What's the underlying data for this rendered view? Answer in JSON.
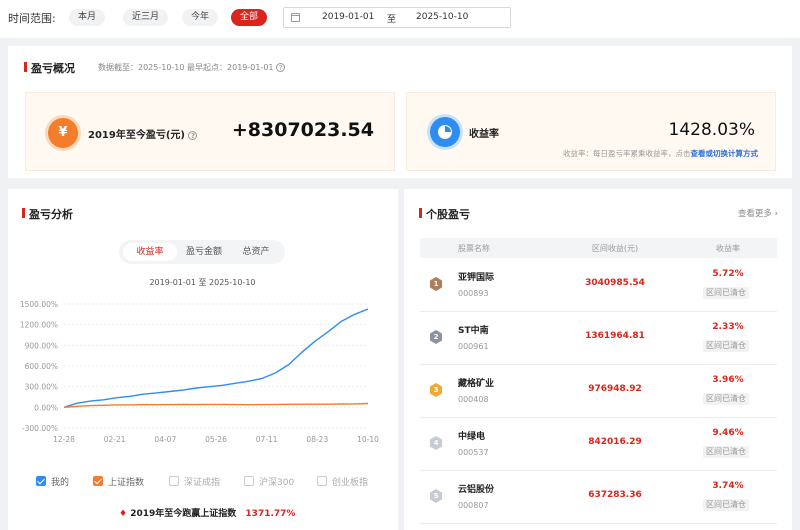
{
  "filter": {
    "label": "时间范围:",
    "options": [
      "本月",
      "近三月",
      "今年",
      "全部"
    ],
    "active": "全部",
    "start": "2019-01-01",
    "to": "至",
    "end": "2025-10-10"
  },
  "overview": {
    "title": "盈亏概况",
    "meta": "数据截至：2025-10-10  最早起点：2019-01-01",
    "profit_label": "2019年至今盈亏(元)",
    "profit_value": "+8307023.54",
    "yield_label": "收益率",
    "yield_value": "1428.03%",
    "note": "收益率：每日盈亏率累乘收益率，点击",
    "note_link": "查看或切换计算方式"
  },
  "analysis": {
    "title": "盈亏分析",
    "tabs": [
      "收益率",
      "盈亏金额",
      "总资产"
    ],
    "active_tab": "收益率",
    "range": "2019-01-01 至 2025-10-10",
    "legend": [
      "我的",
      "上证指数",
      "深证成指",
      "沪深300",
      "创业板指"
    ],
    "legend_on": [
      true,
      true,
      false,
      false,
      false
    ],
    "foot_label": "2019年至今跑赢上证指数",
    "foot_value": "1371.77%"
  },
  "chart_data": {
    "type": "line",
    "x": [
      "2018-12-28",
      "2019-02-21",
      "2019-04-07",
      "2019-05-26",
      "2019-07-11",
      "2019-08-23",
      "2019-10-10"
    ],
    "x_tick_labels": [
      "12-28",
      "02-21",
      "04-07",
      "05-26",
      "07-11",
      "08-23",
      "10-10"
    ],
    "y_tick_labels": [
      "1500.00%",
      "1200.00%",
      "900.00%",
      "600.00%",
      "300.00%",
      "0.00%",
      "-300.00%"
    ],
    "ylim": [
      -300,
      1500
    ],
    "grid": true,
    "legend_position": "bottom",
    "series": [
      {
        "name": "我的",
        "color": "#2f8cf1",
        "values": [
          0,
          60,
          90,
          110,
          140,
          160,
          190,
          210,
          230,
          250,
          280,
          300,
          320,
          350,
          380,
          420,
          500,
          620,
          800,
          960,
          1100,
          1250,
          1350,
          1428
        ]
      },
      {
        "name": "上证指数",
        "color": "#f47d2b",
        "values": [
          0,
          15,
          25,
          30,
          35,
          35,
          40,
          38,
          40,
          42,
          40,
          42,
          42,
          40,
          38,
          40,
          42,
          44,
          45,
          45,
          46,
          48,
          50,
          56
        ]
      }
    ]
  },
  "stocks": {
    "title": "个股盈亏",
    "more": "查看更多",
    "headers": [
      "股票名称",
      "区间收益(元)",
      "收益率"
    ],
    "rows": [
      {
        "rank": "1",
        "name": "亚钾国际",
        "code": "000893",
        "profit": "3040985.54",
        "rate": "5.72%",
        "tag": "区间已清仓",
        "color": "#b07c5a"
      },
      {
        "rank": "2",
        "name": "ST中南",
        "code": "000961",
        "profit": "1361964.81",
        "rate": "2.33%",
        "tag": "区间已清仓",
        "color": "#8a93a3"
      },
      {
        "rank": "3",
        "name": "藏格矿业",
        "code": "000408",
        "profit": "976948.92",
        "rate": "3.96%",
        "tag": "区间已清仓",
        "color": "#f0a93a"
      },
      {
        "rank": "4",
        "name": "中绿电",
        "code": "000537",
        "profit": "842016.29",
        "rate": "9.46%",
        "tag": "区间已清仓",
        "color": "#c7ccd4"
      },
      {
        "rank": "5",
        "name": "云铝股份",
        "code": "000807",
        "profit": "637283.36",
        "rate": "3.74%",
        "tag": "区间已清仓",
        "color": "#c7ccd4"
      }
    ]
  }
}
